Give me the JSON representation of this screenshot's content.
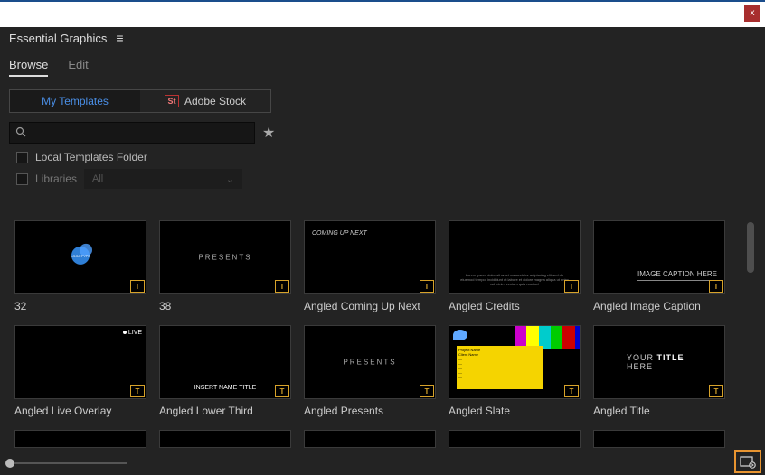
{
  "window": {
    "close": "x"
  },
  "panel": {
    "title": "Essential Graphics"
  },
  "tabs": {
    "browse": "Browse",
    "edit": "Edit"
  },
  "source": {
    "my_templates": "My Templates",
    "adobe_stock": "Adobe Stock",
    "st": "St"
  },
  "search": {
    "placeholder": ""
  },
  "filters": {
    "local_folder": "Local Templates Folder",
    "libraries": "Libraries",
    "lib_selected": "All"
  },
  "thumbs": {
    "presents": "PRESENTS",
    "coming": "COMING UP NEXT",
    "caption": "IMAGE CAPTION HERE",
    "live": "LIVE",
    "lower_a": "INSERT NAME",
    "lower_b": "TITLE",
    "title_a": "YOUR ",
    "title_b": "TITLE",
    "title_c": " HERE",
    "slate_text": "Project Name\nClient Name\n—\n—\n—\n—\n—"
  },
  "items": [
    {
      "label": "32"
    },
    {
      "label": "38"
    },
    {
      "label": "Angled Coming Up Next"
    },
    {
      "label": "Angled Credits"
    },
    {
      "label": "Angled Image Caption"
    },
    {
      "label": "Angled Live Overlay"
    },
    {
      "label": "Angled Lower Third"
    },
    {
      "label": "Angled Presents"
    },
    {
      "label": "Angled Slate"
    },
    {
      "label": "Angled Title"
    }
  ]
}
